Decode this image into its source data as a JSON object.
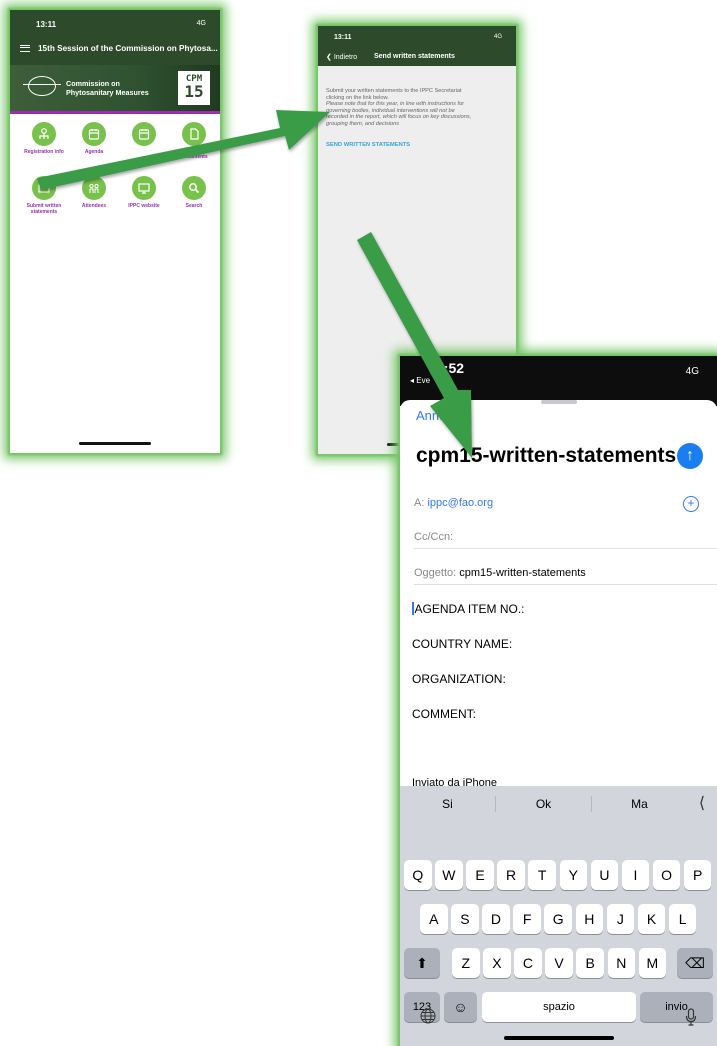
{
  "phone1": {
    "status_time": "13:11",
    "status_signal": "4G",
    "header_title": "15th Session of the Commission on Phytosa...",
    "banner_name_line1": "Commission on",
    "banner_name_line2": "Phytosanitary Measures",
    "banner_badge_top": "CPM",
    "banner_badge_bottom": "15",
    "menu": [
      {
        "label": "Registration info",
        "icon": "person-icon"
      },
      {
        "label": "Agenda",
        "icon": "calendar-icon"
      },
      {
        "label": "",
        "icon": "calendar-icon"
      },
      {
        "label": "Documents",
        "icon": "document-icon"
      },
      {
        "label": "Submit written statements",
        "icon": "envelope-icon"
      },
      {
        "label": "Attendees",
        "icon": "people-icon"
      },
      {
        "label": "IPPC website",
        "icon": "monitor-icon"
      },
      {
        "label": "Search",
        "icon": "search-icon"
      }
    ]
  },
  "phone2": {
    "status_time": "13:11",
    "status_signal": "4G",
    "back_label": "Indietro",
    "title": "Send written statements",
    "text_line1": "Submit your written statements to the IPPC Secretariat",
    "text_line2": "clicking on the link below.",
    "text_italic1": "Please note that for this year, in line with instructions for",
    "text_italic2": "governing bodies, individual interventions will not be",
    "text_italic3": "recorded in the report, which will focus on key discussions,",
    "text_italic4": "grouping them, and decisions",
    "link_label": "SEND WRITTEN STATEMENTS"
  },
  "phone3": {
    "status_time": "3:52",
    "status_prev": "◂ Eve",
    "status_signal": "4G",
    "cancel_label": "Annulla",
    "subject_title": "cpm15-written-statements",
    "to_label": "A:",
    "to_value": "ippc@fao.org",
    "cc_label": "Cc/Ccn:",
    "subject_label": "Oggetto:",
    "subject_value": "cpm15-written-statements",
    "body_lines": [
      "AGENDA ITEM NO.:",
      "COUNTRY NAME:",
      "ORGANIZATION:",
      "COMMENT:"
    ],
    "signature": "Inviato da iPhone",
    "suggestions": [
      "Si",
      "Ok",
      "Ma"
    ],
    "keyboard_row1": [
      "Q",
      "W",
      "E",
      "R",
      "T",
      "Y",
      "U",
      "I",
      "O",
      "P"
    ],
    "keyboard_row2": [
      "A",
      "S",
      "D",
      "F",
      "G",
      "H",
      "J",
      "K",
      "L"
    ],
    "keyboard_row3": [
      "Z",
      "X",
      "C",
      "V",
      "B",
      "N",
      "M"
    ],
    "key_123": "123",
    "key_space": "spazio",
    "key_return": "invio"
  },
  "colors": {
    "header_green": "#2d4a2a",
    "menu_green": "#78c14b",
    "menu_purple": "#9b2fb4",
    "link_blue": "#36a3d9",
    "arrow_green": "#3a9c47",
    "ios_blue": "#3478f6"
  }
}
